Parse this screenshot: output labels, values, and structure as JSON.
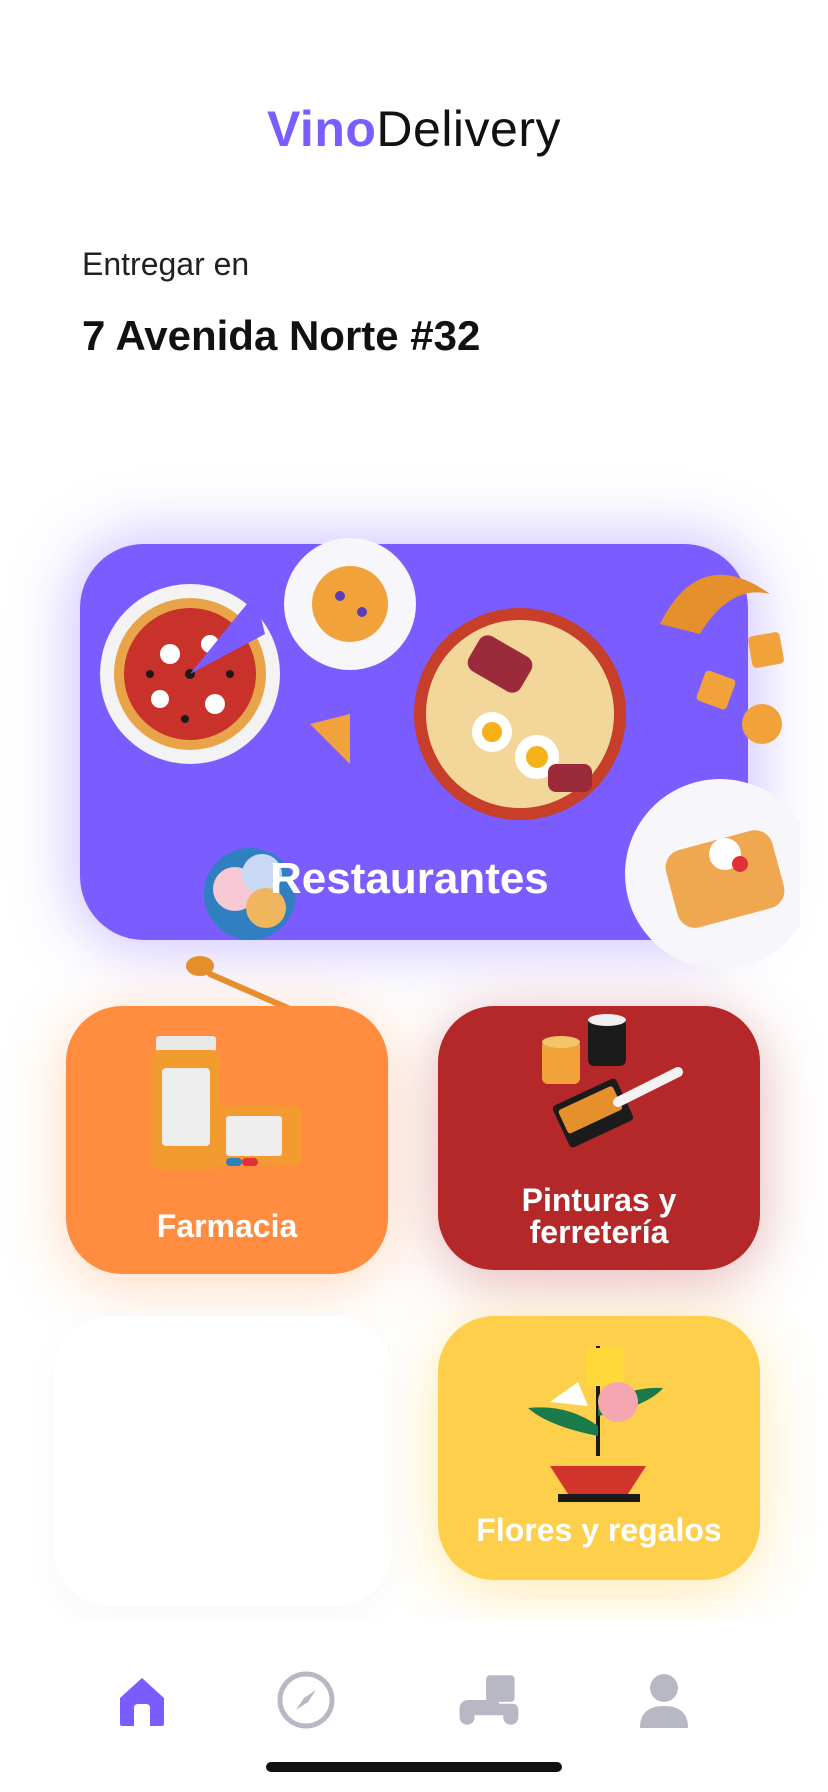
{
  "header": {
    "brand_part1": "Vino",
    "brand_part2": "Delivery"
  },
  "delivery": {
    "label": "Entregar en",
    "address": "7 Avenida Norte #32"
  },
  "categories": {
    "restaurants": "Restaurantes",
    "pharmacy": "Farmacia",
    "paint_line1": "Pinturas y",
    "paint_line2": "ferretería",
    "flowers": "Flores y regalos"
  },
  "tabs": [
    {
      "icon": "home-icon",
      "active": true
    },
    {
      "icon": "compass-icon",
      "active": false
    },
    {
      "icon": "scooter-icon",
      "active": false
    },
    {
      "icon": "profile-icon",
      "active": false
    }
  ],
  "colors": {
    "brand": "#7b5cff",
    "restaurants": "#7b5cff",
    "pharmacy": "#ff8c3f",
    "paint": "#b5282a",
    "flowers": "#fdcf4a",
    "inactive_tab": "#b8b8c4"
  }
}
